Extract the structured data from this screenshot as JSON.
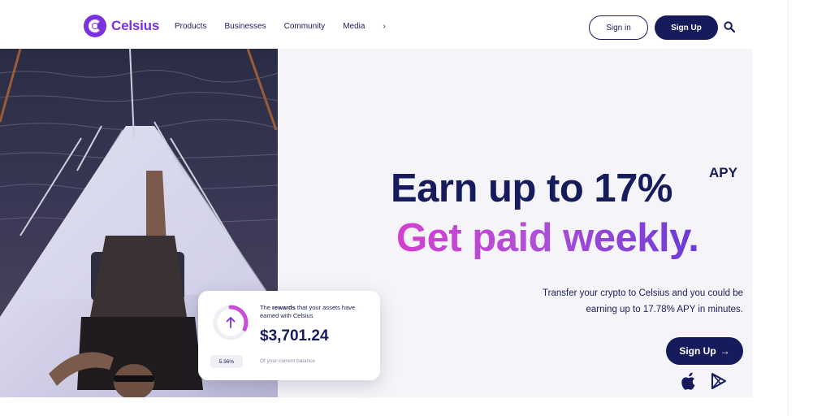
{
  "brand": {
    "name": "Celsius",
    "accent": "#7a32e0",
    "navy": "#161b5c"
  },
  "nav": {
    "items": [
      "Products",
      "Businesses",
      "Community",
      "Media"
    ],
    "more": "›"
  },
  "header": {
    "signin_label": "Sign in",
    "signup_label": "Sign Up",
    "search_icon": "search-icon"
  },
  "hero": {
    "headline_1": "Earn up to 17%",
    "apy": "APY",
    "headline_2": "Get paid weekly.",
    "subtext": "Transfer your crypto to Celsius and you could be earning up to 17.78% APY in minutes.",
    "cta_label": "Sign Up",
    "cta_arrow": "→",
    "store_icons": [
      "apple-icon",
      "google-play-icon"
    ]
  },
  "rewards_card": {
    "desc_pre": "The ",
    "desc_bold": "rewards",
    "desc_post": " that your assets have earned with Celsius",
    "amount": "$3,701.24",
    "percent": "5.96%",
    "foot": "Of your current balance",
    "progress_fraction": 0.32
  }
}
